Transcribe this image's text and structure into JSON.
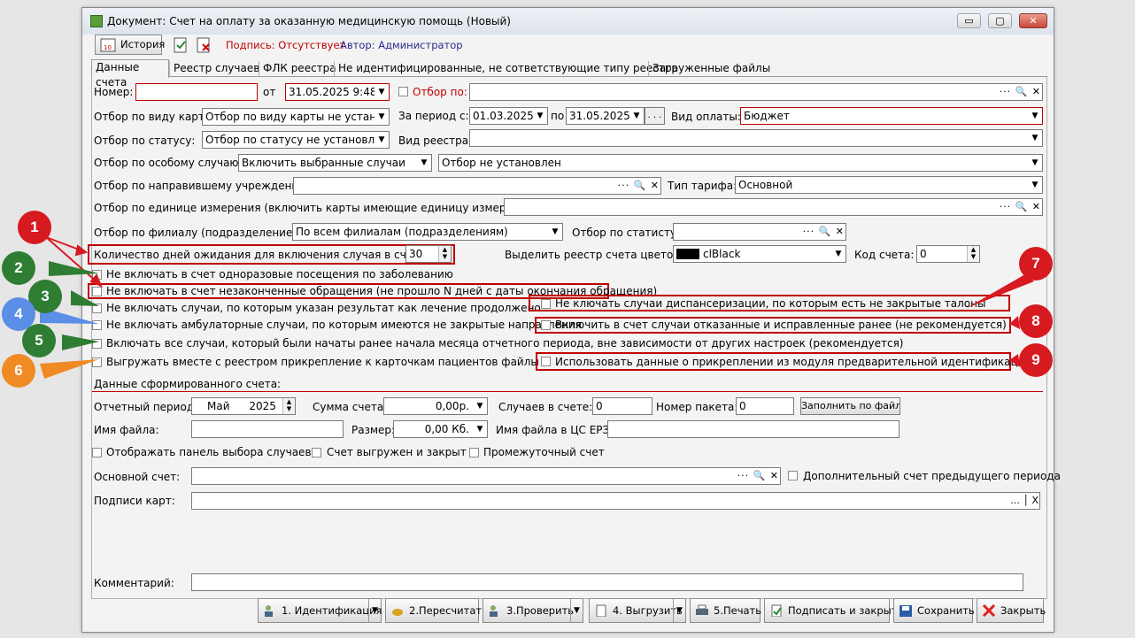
{
  "window": {
    "title": "Документ: Счет на оплату за оказанную медицинскую помощь (Новый)",
    "min": "▭",
    "max": "▢",
    "close": "✕"
  },
  "toolbar": {
    "history": "История",
    "signature": "Подпись: Отсутствует",
    "author": "Автор: Администратор"
  },
  "tabs": [
    "Данные счета",
    "Реестр случаев",
    "ФЛК реестра",
    "Не идентифицированные, не сответствующие типу реестра",
    "Загруженные файлы"
  ],
  "form": {
    "number_label": "Номер:",
    "from_label": "от",
    "date": "31.05.2025 9:48:",
    "filter_by_label": "Отбор по:",
    "card_type_label": "Отбор по виду карт:",
    "card_type_value": "Отбор по виду карты не установ",
    "period_label": "За период с:",
    "period_from": "01.03.2025",
    "period_po": "по",
    "period_to": "31.05.2025",
    "period_btn": ". . .",
    "payment_label": "Вид оплаты:",
    "payment_value": "Бюджет",
    "status_label": "Отбор по статусу:",
    "status_value": "Отбор по статусу не установлен",
    "registry_type_label": "Вид реестра:",
    "special_label": "Отбор по особому случаю:",
    "special_value": "Включить выбранные случаи",
    "special_value2": "Отбор не установлен",
    "referral_label": "Отбор по направившему учреждению:",
    "tariff_label": "Тип тарифа:",
    "tariff_value": "Основной",
    "unit_label": "Отбор по единице измерения (включить карты имеющие единицу измерения):",
    "branch_label": "Отбор по филиалу (подразделение):",
    "branch_value": "По всем филиалам (подразделениям)",
    "statistician_label": "Отбор по статисту:",
    "wait_days_label": "Количество дней ожидания для включения случая в счет:",
    "wait_days_value": "30",
    "color_label": "Выделить реестр счета цветом:",
    "color_value": "clBlack",
    "account_code_label": "Код счета:",
    "account_code_value": "0"
  },
  "checks_left": [
    "Не включать в счет одноразовые посещения по заболеванию",
    "Не включать в счет незаконченные обращения (не прошло N дней с даты окончания обращения)",
    "Не включать случаи, по которым указан результат как лечение продолжено.",
    "Не включать амбулаторные случаи, по которым имеются не закрытые направления",
    "Включать все случаи, который были начаты ранее начала месяца отчетного периода, вне зависимости от других настроек (рекомендуется)",
    "Выгружать вместе с реестром прикрепление к карточкам пациентов файлы"
  ],
  "checks_right": [
    "Не ключать случаи диспансеризации, по которым есть не закрытые талоны",
    "Включить в счет случаи отказанные и исправленные ранее (не рекомендуется)",
    "Использовать данные о прикреплении из модуля предварительной идентификации"
  ],
  "generated": {
    "section_title": "Данные сформированного счета:",
    "period_label": "Отчетный период:",
    "period_month": "Май",
    "period_year": "2025",
    "sum_label": "Сумма счета:",
    "sum_value": "0,00р.",
    "cases_label": "Случаев в счете:",
    "cases_value": "0",
    "packet_label": "Номер пакета:",
    "packet_value": "0",
    "fill_btn": "Заполнить по файлу",
    "filename_label": "Имя файла:",
    "size_label": "Размер:",
    "size_value": "0,00 Кб.",
    "erz_label": "Имя файла в ЦС ЕРЗ:",
    "show_panel": "Отображать панель выбора случаев",
    "exported": "Счет выгружен и закрыт",
    "intermediate": "Промежуточный счет",
    "main_account_label": "Основной счет:",
    "additional": "Дополнительный счет предыдущего периода",
    "card_signs_label": "Подписи карт:",
    "comment_label": "Комментарий:"
  },
  "buttons": [
    "1. Идентификация",
    "2.Пересчитать",
    "3.Проверить",
    "4. Выгрузить",
    "5.Печать",
    "Подписать и закрыть",
    "Сохранить",
    "Закрыть"
  ],
  "callouts": [
    "1",
    "2",
    "3",
    "4",
    "5",
    "6",
    "7",
    "8",
    "9"
  ],
  "colors": {
    "red": "#c00000",
    "green": "#2e7d32",
    "blue": "#5b8ee6",
    "orange": "#f08a24",
    "callout_red": "#d71920"
  }
}
